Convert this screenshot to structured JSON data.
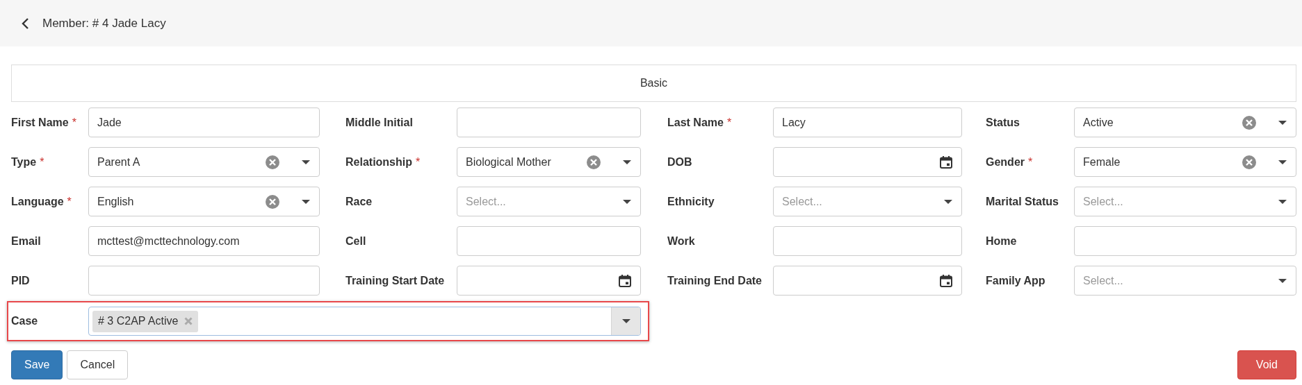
{
  "header": {
    "title": "Member: # 4 Jade Lacy"
  },
  "section": {
    "title": "Basic"
  },
  "fields": [
    {
      "label": "First Name",
      "required_mark": "*",
      "kind": "text",
      "value": "Jade"
    },
    {
      "label": "Middle Initial",
      "kind": "text"
    },
    {
      "label": "Last Name",
      "required_mark": "*",
      "kind": "text",
      "value": "Lacy"
    },
    {
      "label": "Status",
      "kind": "select",
      "value": "Active"
    },
    {
      "label": "Type",
      "required_mark": "*",
      "kind": "select",
      "value": "Parent A"
    },
    {
      "label": "Relationship",
      "required_mark": "*",
      "kind": "select",
      "value": "Biological Mother"
    },
    {
      "label": "DOB",
      "kind": "date"
    },
    {
      "label": "Gender",
      "required_mark": "*",
      "kind": "select",
      "value": "Female"
    },
    {
      "label": "Language",
      "required_mark": "*",
      "kind": "select",
      "value": "English"
    },
    {
      "label": "Race",
      "kind": "select",
      "placeholder": "Select..."
    },
    {
      "label": "Ethnicity",
      "kind": "select",
      "placeholder": "Select..."
    },
    {
      "label": "Marital Status",
      "kind": "select",
      "placeholder": "Select..."
    },
    {
      "label": "Email",
      "kind": "text",
      "value": "mcttest@mcttechnology.com"
    },
    {
      "label": "Cell",
      "kind": "text"
    },
    {
      "label": "Work",
      "kind": "text"
    },
    {
      "label": "Home",
      "kind": "text"
    },
    {
      "label": "PID",
      "kind": "text"
    },
    {
      "label": "Training Start Date",
      "kind": "date"
    },
    {
      "label": "Training End Date",
      "kind": "date"
    },
    {
      "label": "Family App",
      "kind": "select",
      "placeholder": "Select..."
    }
  ],
  "case": {
    "label": "Case",
    "highlighted": true,
    "tags": [
      {
        "text": "# 3 C2AP Active"
      }
    ]
  },
  "buttons": [
    {
      "label": "Save",
      "kind": "primary"
    },
    {
      "label": "Cancel",
      "kind": "default"
    },
    {
      "label": "Void",
      "kind": "danger"
    }
  ]
}
